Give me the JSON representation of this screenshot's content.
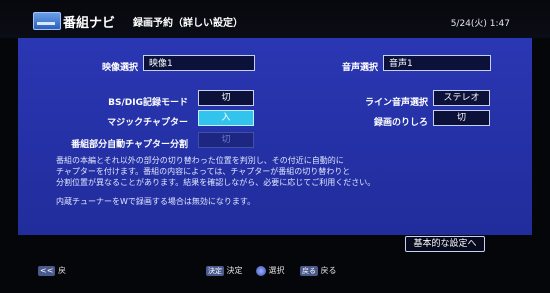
{
  "header": {
    "logo_icon": "tv-guide-icon",
    "app_title": "番組ナビ",
    "screen_title": "録画予約（詳しい設定）",
    "datetime": "5/24(火) 1:47"
  },
  "form": {
    "video_select": {
      "label": "映像選択",
      "value": "映像1"
    },
    "audio_select": {
      "label": "音声選択",
      "value": "音声1"
    },
    "bs_cs_mode": {
      "label": "BS/DIG記録モード",
      "value": "切"
    },
    "line_audio": {
      "label": "ライン音声選択",
      "value": "ステレオ"
    },
    "magic_chapter": {
      "label": "マジックチャプター",
      "value": "入"
    },
    "recording_margin": {
      "label": "録画のりしろ",
      "value": "切"
    },
    "auto_chapter_split": {
      "label": "番組部分自動チャプター分割",
      "value": "切"
    }
  },
  "notice": {
    "line1": "番組の本編とそれ以外の部分の切り替わった位置を判別し、その付近に自動的に",
    "line2": "チャプターを付けます。番組の内容によっては、チャプターが番組の切り替わりと",
    "line3": "分割位置が異なることがあります。結果を確認しながら、必要に応じてご利用ください。",
    "line4": "内蔵チューナーをWで録画する場合は無効になります。"
  },
  "basic_settings_button": "基本的な設定へ",
  "footer": {
    "back_key": "<<",
    "back_label": "戻",
    "enter_key": "決定",
    "enter_label": "決定",
    "select_label": "選択",
    "return_key": "戻る",
    "return_label": "戻る"
  }
}
